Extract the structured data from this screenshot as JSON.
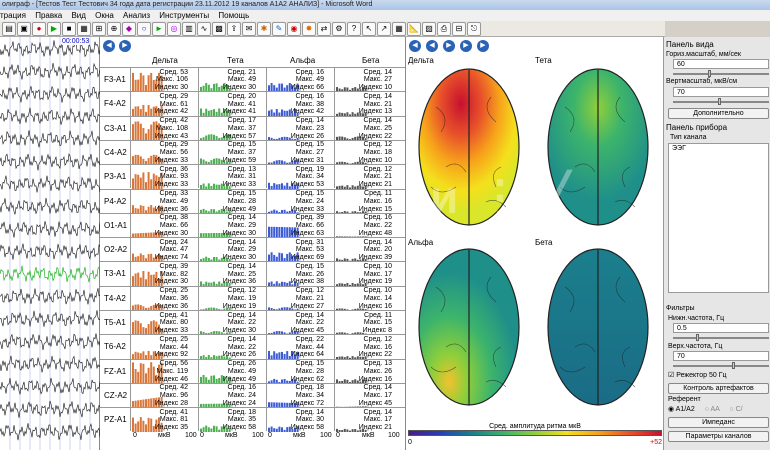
{
  "titlebar": {
    "text": "олиграф - [Тестов Тест Тестович 34 года дата регистрации 23.11.2012 19 каналов А1А2 АНАЛИЗ] - Microsoft Word"
  },
  "menu": [
    "трация",
    "Правка",
    "Вид",
    "Окна",
    "Анализ",
    "Инструменты",
    "Помощь"
  ],
  "eeg": {
    "time": "00:00:53"
  },
  "bands": [
    "Дельта",
    "Тета",
    "Альфа",
    "Бета"
  ],
  "stat_labels": {
    "avg": "Сред.",
    "max": "Макс.",
    "idx": "Индекс"
  },
  "channels": [
    {
      "name": "F3-A1",
      "d": [
        53,
        106,
        30
      ],
      "t": [
        21,
        49,
        30
      ],
      "a": [
        16,
        49,
        66
      ],
      "b": [
        14,
        27,
        10
      ]
    },
    {
      "name": "F4-A2",
      "d": [
        29,
        61,
        42
      ],
      "t": [
        20,
        41,
        41
      ],
      "a": [
        16,
        38,
        42
      ],
      "b": [
        14,
        21,
        13
      ]
    },
    {
      "name": "C3-A1",
      "d": [
        42,
        108,
        43
      ],
      "t": [
        17,
        37,
        57
      ],
      "a": [
        14,
        23,
        26
      ],
      "b": [
        14,
        25,
        22
      ]
    },
    {
      "name": "C4-A2",
      "d": [
        29,
        56,
        33
      ],
      "t": [
        15,
        37,
        59
      ],
      "a": [
        15,
        27,
        31
      ],
      "b": [
        12,
        18,
        10
      ]
    },
    {
      "name": "P3-A1",
      "d": [
        36,
        93,
        33
      ],
      "t": [
        13,
        31,
        33
      ],
      "a": [
        19,
        34,
        53
      ],
      "b": [
        12,
        21,
        21
      ]
    },
    {
      "name": "P4-A2",
      "d": [
        33,
        49,
        36
      ],
      "t": [
        15,
        28,
        49
      ],
      "a": [
        15,
        24,
        33
      ],
      "b": [
        11,
        16,
        15
      ]
    },
    {
      "name": "O1-A1",
      "d": [
        38,
        66,
        30
      ],
      "t": [
        14,
        29,
        30
      ],
      "a": [
        39,
        66,
        63
      ],
      "b": [
        16,
        22,
        48
      ]
    },
    {
      "name": "O2-A2",
      "d": [
        24,
        47,
        74
      ],
      "t": [
        14,
        29,
        30
      ],
      "a": [
        31,
        53,
        69
      ],
      "b": [
        14,
        20,
        39
      ]
    },
    {
      "name": "T3-A1",
      "d": [
        39,
        82,
        30
      ],
      "t": [
        14,
        25,
        36
      ],
      "a": [
        15,
        26,
        38
      ],
      "b": [
        10,
        17,
        19
      ]
    },
    {
      "name": "T4-A2",
      "d": [
        25,
        36,
        36
      ],
      "t": [
        12,
        19,
        19
      ],
      "a": [
        12,
        21,
        27
      ],
      "b": [
        10,
        14,
        16
      ]
    },
    {
      "name": "T5-A1",
      "d": [
        41,
        80,
        33
      ],
      "t": [
        14,
        22,
        30
      ],
      "a": [
        14,
        22,
        45
      ],
      "b": [
        11,
        15,
        8
      ]
    },
    {
      "name": "T6-A2",
      "d": [
        25,
        44,
        92
      ],
      "t": [
        14,
        22,
        26
      ],
      "a": [
        22,
        44,
        64
      ],
      "b": [
        12,
        16,
        22
      ]
    },
    {
      "name": "FZ-A1",
      "d": [
        56,
        119,
        46
      ],
      "t": [
        26,
        49,
        49
      ],
      "a": [
        15,
        28,
        62
      ],
      "b": [
        13,
        26,
        16
      ]
    },
    {
      "name": "CZ-A2",
      "d": [
        42,
        96,
        28
      ],
      "t": [
        16,
        24,
        24
      ],
      "a": [
        18,
        34,
        72
      ],
      "b": [
        14,
        17,
        45
      ]
    },
    {
      "name": "PZ-A1",
      "d": [
        41,
        81,
        35
      ],
      "t": [
        18,
        35,
        58
      ],
      "a": [
        14,
        30,
        58
      ],
      "b": [
        14,
        17,
        21
      ]
    }
  ],
  "spectrum_axis": {
    "zero": "0",
    "unit": "мкВ",
    "max": "100"
  },
  "maps": {
    "labels": [
      "Дельта",
      "Тета",
      "Альфа",
      "Бета"
    ],
    "legend_title": "Сред. амплитуда ритма мкВ",
    "legend_min": "0",
    "legend_max": "+52"
  },
  "panel": {
    "view_title": "Панель вида",
    "hscale_label": "Гориз.масштаб, мм/сек",
    "hscale_value": "60",
    "vscale_label": "Вертмасштаб, мкВ/см",
    "vscale_value": "70",
    "more_button": "Дополнительно",
    "device_title": "Панель прибора",
    "channel_type_label": "Тип канала",
    "channel_type_value": "ЭЭГ",
    "filters_label": "Фильтры",
    "low_label": "Нижн.частота, Гц",
    "low_value": "0.5",
    "high_label": "Верх.частота, Гц",
    "high_value": "70",
    "notch_label": "Режектор 50 Гц",
    "artifact_button": "Контроль артефактов",
    "ref_label": "Референт",
    "ref_options": [
      "A1/A2",
      "AA",
      "C/"
    ],
    "impedance_button": "Импеданс",
    "params_button": "Параметры каналов"
  },
  "colors": {
    "delta": "#d9763a",
    "theta": "#4caf50",
    "alpha": "#3c5bd4",
    "beta": "#555555",
    "accent": "#2a62b5"
  }
}
